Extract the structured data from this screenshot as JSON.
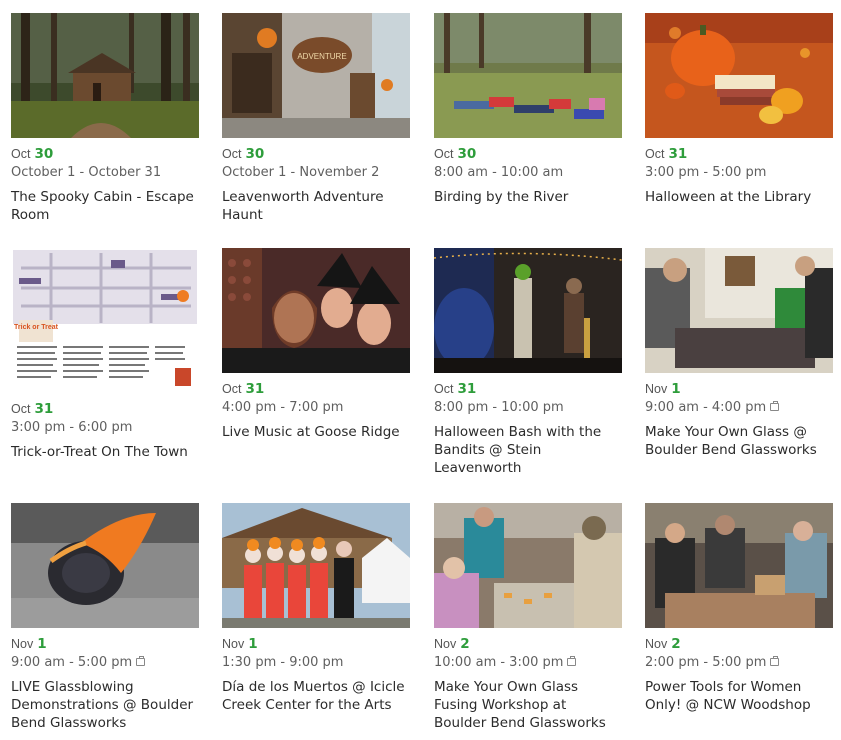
{
  "events": [
    {
      "month": "Oct",
      "day": "30",
      "time": "October 1 - October 31",
      "repeat": false,
      "title": "The Spooky Cabin - Escape Room",
      "image": "cabin-in-forest"
    },
    {
      "month": "Oct",
      "day": "30",
      "time": "October 1 - November 2",
      "repeat": false,
      "title": "Leavenworth Adventure Haunt",
      "image": "adventure-haunt-gate"
    },
    {
      "month": "Oct",
      "day": "30",
      "time": "8:00 am - 10:00 am",
      "repeat": false,
      "title": "Birding by the River",
      "image": "kids-lying-on-grass"
    },
    {
      "month": "Oct",
      "day": "31",
      "time": "3:00 pm - 5:00 pm",
      "repeat": false,
      "title": "Halloween at the Library",
      "image": "pumpkin-and-books"
    },
    {
      "month": "Oct",
      "day": "31",
      "time": "3:00 pm - 6:00 pm",
      "repeat": false,
      "title": "Trick-or-Treat On The Town",
      "image": "trick-or-treat-map",
      "image_text": "Trick or Treat"
    },
    {
      "month": "Oct",
      "day": "31",
      "time": "4:00 pm - 7:00 pm",
      "repeat": false,
      "title": "Live Music at Goose Ridge",
      "image": "women-in-witch-hats"
    },
    {
      "month": "Oct",
      "day": "31",
      "time": "8:00 pm - 10:00 pm",
      "repeat": false,
      "title": "Halloween Bash with the Bandits @ Stein Leavenworth",
      "image": "band-on-stage"
    },
    {
      "month": "Nov",
      "day": "1",
      "time": "9:00 am - 4:00 pm",
      "repeat": true,
      "title": "Make Your Own Glass @ Boulder Bend Glassworks",
      "image": "glass-workshop"
    },
    {
      "month": "Nov",
      "day": "1",
      "time": "9:00 am - 5:00 pm",
      "repeat": true,
      "title": "LIVE Glassblowing Demonstrations @ Boulder Bend Glassworks",
      "image": "molten-glass"
    },
    {
      "month": "Nov",
      "day": "1",
      "time": "1:30 pm - 9:00 pm",
      "repeat": false,
      "title": "Día de los Muertos @ Icicle Creek Center for the Arts",
      "image": "dia-de-los-muertos-dancers"
    },
    {
      "month": "Nov",
      "day": "2",
      "time": "10:00 am - 3:00 pm",
      "repeat": true,
      "title": "Make Your Own Glass Fusing Workshop at Boulder Bend Glassworks",
      "image": "glass-fusing-class"
    },
    {
      "month": "Nov",
      "day": "2",
      "time": "2:00 pm - 5:00 pm",
      "repeat": true,
      "title": "Power Tools for Women Only! @ NCW Woodshop",
      "image": "woodshop-class"
    }
  ]
}
